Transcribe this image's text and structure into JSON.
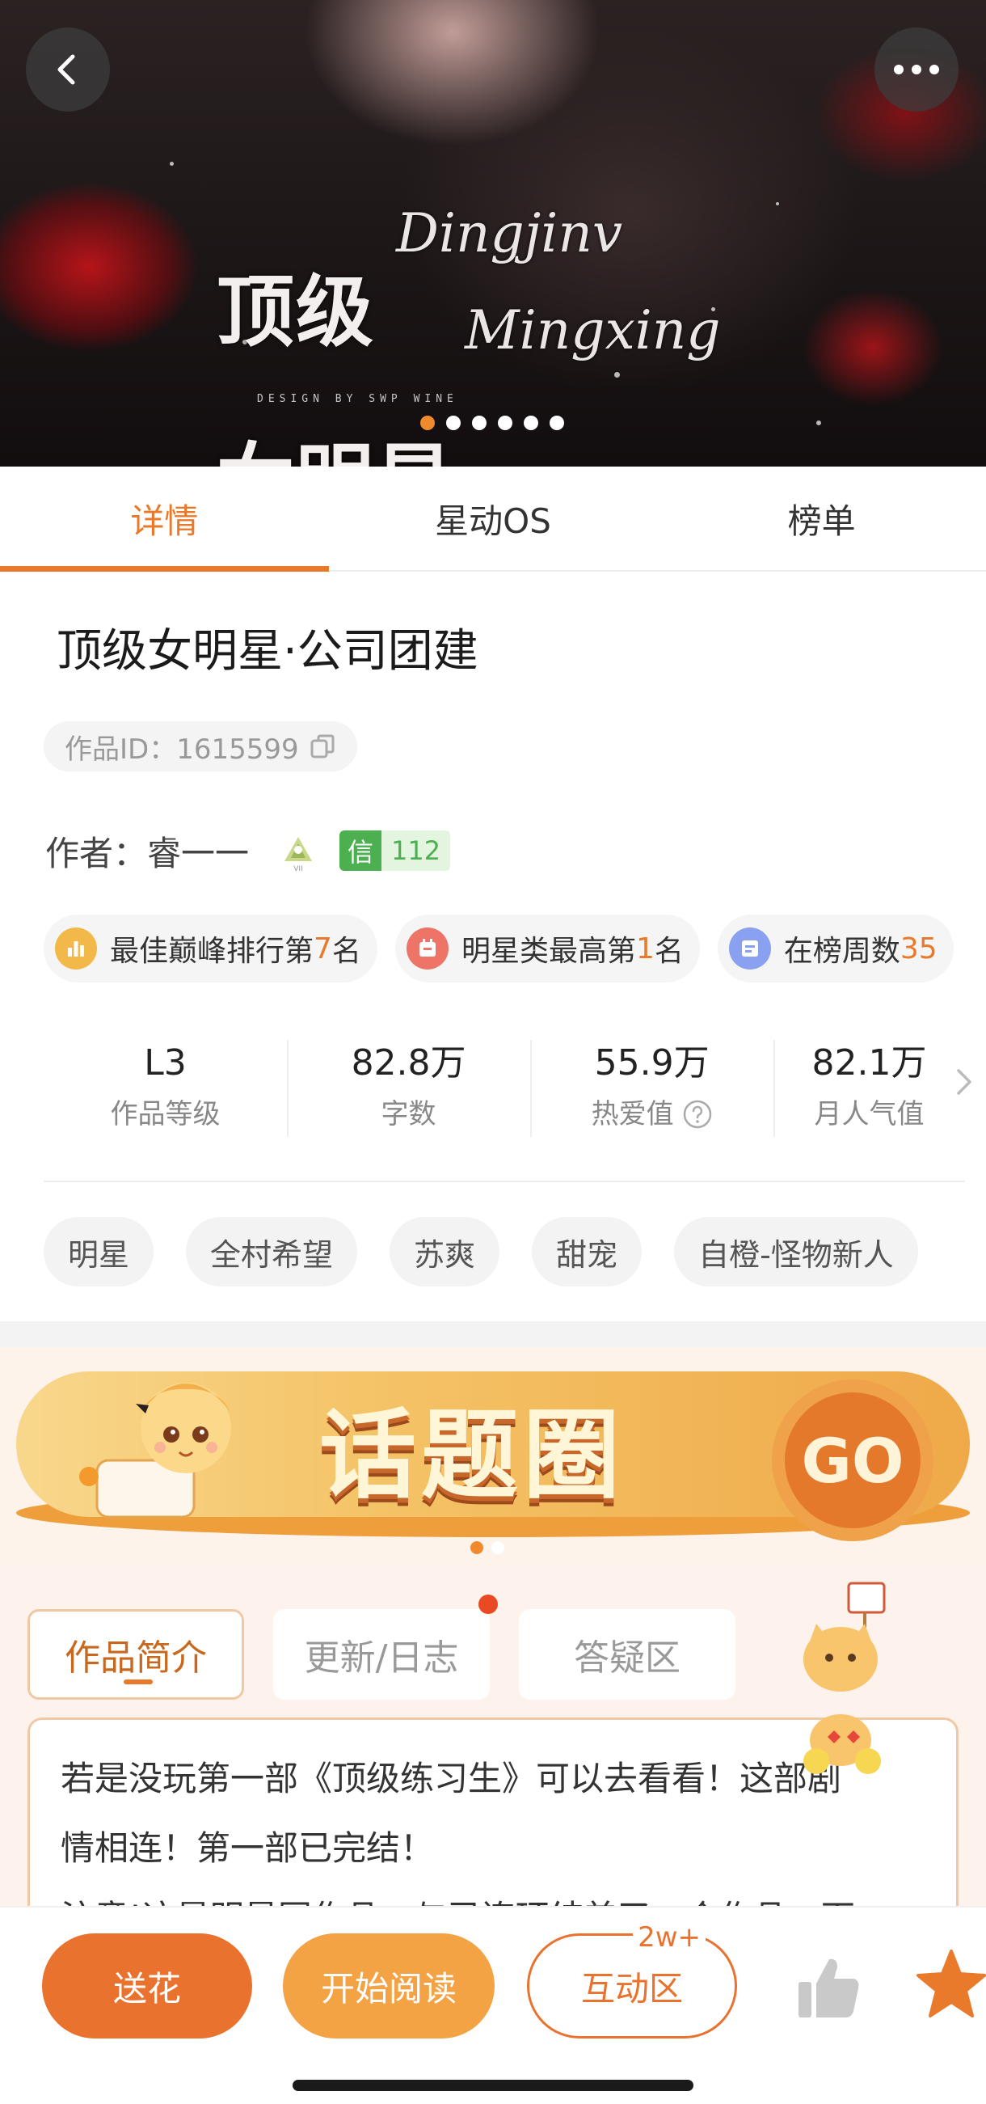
{
  "hero": {
    "title_line1": "顶级",
    "title_line2": "女明星",
    "script_line1": "Dingjinv",
    "script_line2": "Mingxing",
    "design_text": "DESIGN BY SWP WINE",
    "carousel_count": 6,
    "carousel_active": 0,
    "back_icon": "chevron-left-icon",
    "more_icon": "more-horizontal-icon"
  },
  "tabs": [
    {
      "label": "详情",
      "active": true
    },
    {
      "label": "星动OS",
      "active": false
    },
    {
      "label": "榜单",
      "active": false
    }
  ],
  "work": {
    "title": "顶级女明星·公司团建",
    "id_label": "作品ID：1615599",
    "copy_icon": "copy-icon"
  },
  "author": {
    "label": "作者：",
    "name": "睿一一",
    "badge_icon": "author-level-badge-icon",
    "trust_key": "信",
    "trust_value": "112"
  },
  "ranks": [
    {
      "prefix": "最佳巅峰排行第",
      "num": "7",
      "suffix": "名",
      "icon": "bar-chart-icon",
      "color": "#f3b84a"
    },
    {
      "prefix": "明星类最高第",
      "num": "1",
      "suffix": "名",
      "icon": "calendar-icon",
      "color": "#ef7468"
    },
    {
      "prefix": "在榜周数",
      "num": "35",
      "suffix": "",
      "icon": "list-icon",
      "color": "#8aa0f0"
    }
  ],
  "stats": [
    {
      "value": "L3",
      "label": "作品等级"
    },
    {
      "value": "82.8万",
      "label": "字数"
    },
    {
      "value": "55.9万",
      "label": "热爱值"
    },
    {
      "value": "82.1万",
      "label": "月人气值"
    }
  ],
  "tags": [
    "明星",
    "全村希望",
    "苏爽",
    "甜宠",
    "自橙-怪物新人"
  ],
  "topic_banner": {
    "text": "话题圈",
    "go_label": "GO",
    "dots": 2,
    "active_dot": 0
  },
  "sub_tabs": [
    {
      "label": "作品简介",
      "active": true
    },
    {
      "label": "更新/日志",
      "active": false,
      "red_dot": true
    },
    {
      "label": "答疑区",
      "active": false
    }
  ],
  "intro": {
    "line1": "若是没玩第一部《顶级练习生》可以去看看！这部剧",
    "line2": "情相连！第一部已完结！",
    "line3": "注意!这是明星同作品，与已连环结美了一个作品一下"
  },
  "bottom_bar": {
    "flower_label": "送花",
    "read_label": "开始阅读",
    "interact_label": "互动区",
    "interact_badge": "2w+",
    "like_icon": "thumbs-up-icon",
    "favorite_icon": "star-icon"
  },
  "colors": {
    "accent": "#ea7a2b",
    "accent_light": "#f3a244",
    "trust_green": "#4caf50"
  }
}
